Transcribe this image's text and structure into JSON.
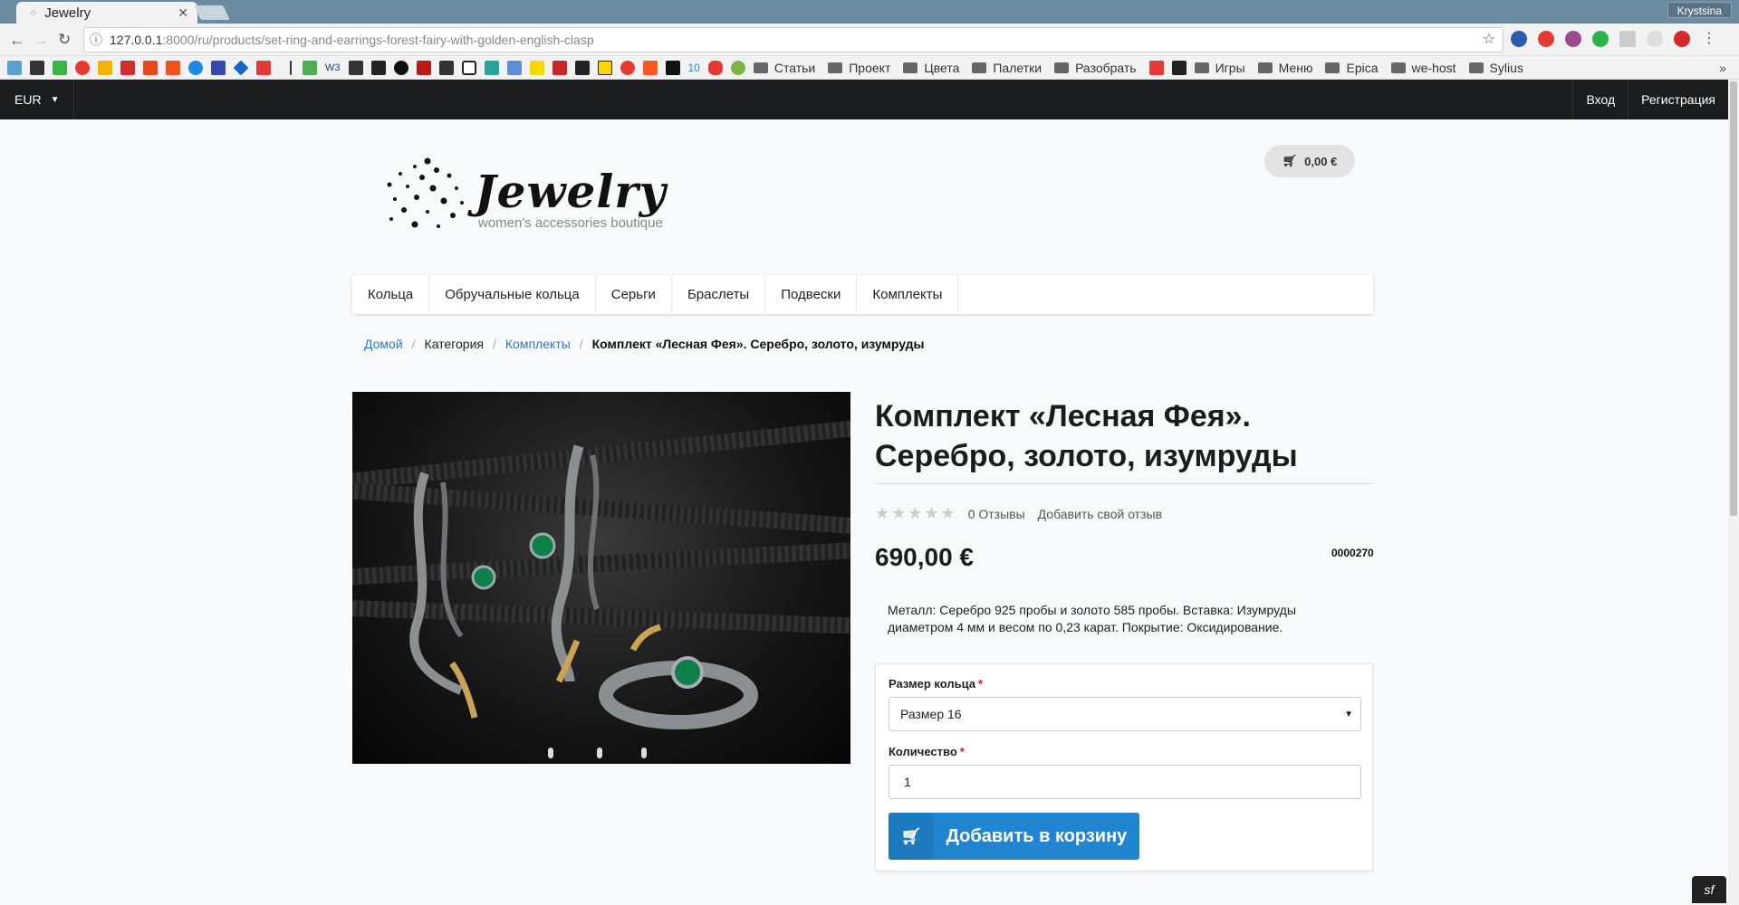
{
  "browser": {
    "tab_title": "Jewelry",
    "user": "Krystsina",
    "url_host": "127.0.0.1",
    "url_rest": ":8000/ru/products/set-ring-and-earrings-forest-fairy-with-golden-english-clasp",
    "bookmark_folders": [
      "Статьи",
      "Проект",
      "Цвета",
      "Палетки",
      "Разобрать",
      "Игры",
      "Меню",
      "Epica",
      "we-host",
      "Sylius"
    ],
    "bookmark_labels": [
      "W3",
      "10"
    ]
  },
  "site": {
    "currency": "EUR",
    "login": "Вход",
    "register": "Регистрация",
    "logo_word": "Jewelry",
    "logo_tagline": "women's accessories boutique",
    "cart_total": "0,00 €",
    "menu": [
      "Кольца",
      "Обручальные кольца",
      "Серьги",
      "Браслеты",
      "Подвески",
      "Комплекты"
    ],
    "breadcrumbs": {
      "home": "Домой",
      "category": "Категория",
      "section": "Комплекты",
      "current": "Комплект «Лесная Фея». Серебро, золото, изумруды"
    }
  },
  "product": {
    "title": "Комплект «Лесная Фея». Серебро, золото, изумруды",
    "reviews": "0 Отзывы",
    "add_review": "Добавить свой отзыв",
    "rating": 0,
    "price": "690,00 €",
    "sku": "0000270",
    "description": "Металл: Серебро 925 пробы и золото 585 пробы. Вставка: Изумруды диаметром 4 мм и весом по 0,23 карат. Покрытие: Оксидирование.",
    "size_label": "Размер кольца",
    "size_value": "Размер 16",
    "qty_label": "Количество",
    "qty_value": "1",
    "add_to_cart": "Добавить в корзину"
  }
}
